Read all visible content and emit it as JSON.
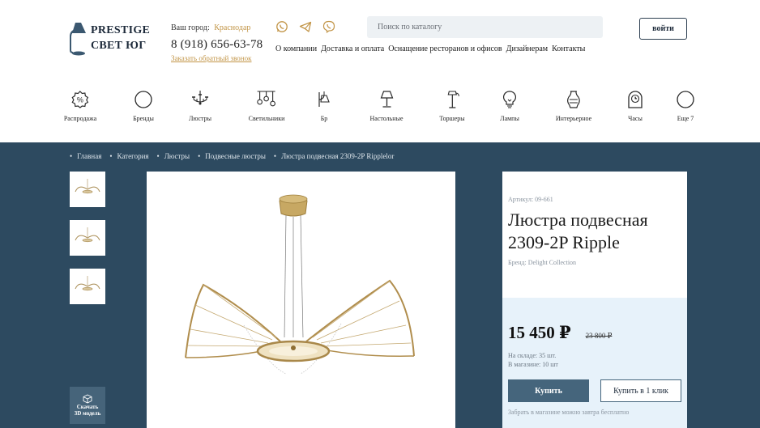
{
  "header": {
    "logo_line1": "PRESTIGE",
    "logo_line2": "СВЕТ ЮГ",
    "city_label": "Ваш город:",
    "city_name": "Краснодар",
    "phone": "8 (918) 656-63-78",
    "callback_link": "Заказать обратный звонок",
    "search_placeholder": "Поиск по каталогу",
    "login_label": "войти",
    "socials": [
      "whatsapp-icon",
      "telegram-icon",
      "viber-icon"
    ],
    "nav": [
      "О компании",
      "Доставка и оплата",
      "Оснащение ресторанов и офисов",
      "Дизайнерам",
      "Контакты"
    ]
  },
  "categories": [
    {
      "label": "Распродажа",
      "icon": "sale-badge-icon"
    },
    {
      "label": "Бренды",
      "icon": "circle-icon"
    },
    {
      "label": "Люстры",
      "icon": "chandelier-icon"
    },
    {
      "label": "Светильники",
      "icon": "pendant-lights-icon"
    },
    {
      "label": "Бр",
      "icon": "sconce-icon"
    },
    {
      "label": "Настольные",
      "icon": "table-lamp-icon"
    },
    {
      "label": "Торшеры",
      "icon": "floor-lamp-icon"
    },
    {
      "label": "Лампы",
      "icon": "bulb-icon"
    },
    {
      "label": "Интерьерное",
      "icon": "vase-icon"
    },
    {
      "label": "Часы",
      "icon": "clock-icon"
    },
    {
      "label": "Еще 7",
      "icon": "circle-icon"
    }
  ],
  "breadcrumb": [
    "Главная",
    "Категория",
    "Люстры",
    "Подвесные люстры",
    "Люстра подвесная 2309-2P Ripplelor"
  ],
  "download_3d": {
    "line1": "Скачать",
    "line2": "3D модель"
  },
  "product": {
    "sku": "Артикул: 09-661",
    "title_line1": "Люстра подвесная",
    "title_line2": "2309-2P Ripple",
    "brand": "Бренд: Delight Collection",
    "price": "15 450 ₽",
    "old_price": "23 800 ₽",
    "stock_warehouse": "На складе: 35 шт.",
    "stock_store": "В магазине: 10 шт",
    "buy_label": "Купить",
    "oneclick_label": "Купить в 1 клик",
    "note": "Забрать в магазине можно завтра бесплатно"
  },
  "colors": {
    "accent_gold": "#c29547",
    "dark_panel": "#2d4a60",
    "buy_button": "#45657c",
    "price_panel": "#e7f2fa"
  }
}
